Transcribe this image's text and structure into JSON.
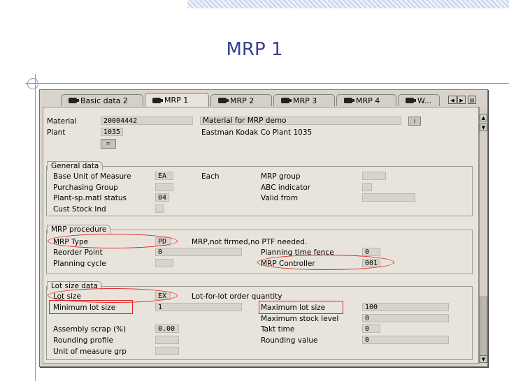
{
  "slide": {
    "title": "MRP 1"
  },
  "tabs": [
    {
      "label": "Basic data 2"
    },
    {
      "label": "MRP 1"
    },
    {
      "label": "MRP 2"
    },
    {
      "label": "MRP 3"
    },
    {
      "label": "MRP 4"
    },
    {
      "label": "W..."
    }
  ],
  "header": {
    "material_label": "Material",
    "material_value": "20004442",
    "material_desc": "Material for MRP demo",
    "plant_label": "Plant",
    "plant_value": "1035",
    "plant_desc": "Eastman Kodak Co Plant 1035"
  },
  "general": {
    "title": "General data",
    "base_uom_label": "Base Unit of Measure",
    "base_uom_value": "EA",
    "base_uom_text": "Each",
    "purch_group_label": "Purchasing Group",
    "plant_status_label": "Plant-sp.matl status",
    "plant_status_value": "04",
    "cust_stock_label": "Cust Stock Ind",
    "mrp_group_label": "MRP group",
    "abc_label": "ABC indicator",
    "valid_from_label": "Valid from"
  },
  "procedure": {
    "title": "MRP procedure",
    "mrp_type_label": "MRP Type",
    "mrp_type_value": "PD",
    "mrp_type_text": "MRP,not firmed,no PTF needed.",
    "reorder_label": "Reorder Point",
    "reorder_value": "0",
    "planning_cycle_label": "Planning cycle",
    "ptf_label": "Planning time fence",
    "ptf_value": "0",
    "controller_label": "MRP Controller",
    "controller_value": "001"
  },
  "lotsize": {
    "title": "Lot size data",
    "lot_size_label": "Lot size",
    "lot_size_value": "EX",
    "lot_size_text": "Lot-for-lot order quantity",
    "min_label": "Minimum lot size",
    "min_value": "1",
    "max_label": "Maximum lot size",
    "max_value": "100",
    "max_stock_label": "Maximum stock level",
    "max_stock_value": "0",
    "scrap_label": "Assembly scrap (%)",
    "scrap_value": "0.00",
    "takt_label": "Takt time",
    "takt_value": "0",
    "rounding_profile_label": "Rounding profile",
    "rounding_value_label": "Rounding value",
    "rounding_value_value": "0",
    "uom_grp_label": "Unit of measure grp"
  },
  "colors": {
    "annotation": "#e02020",
    "title": "#3a3f8f"
  }
}
